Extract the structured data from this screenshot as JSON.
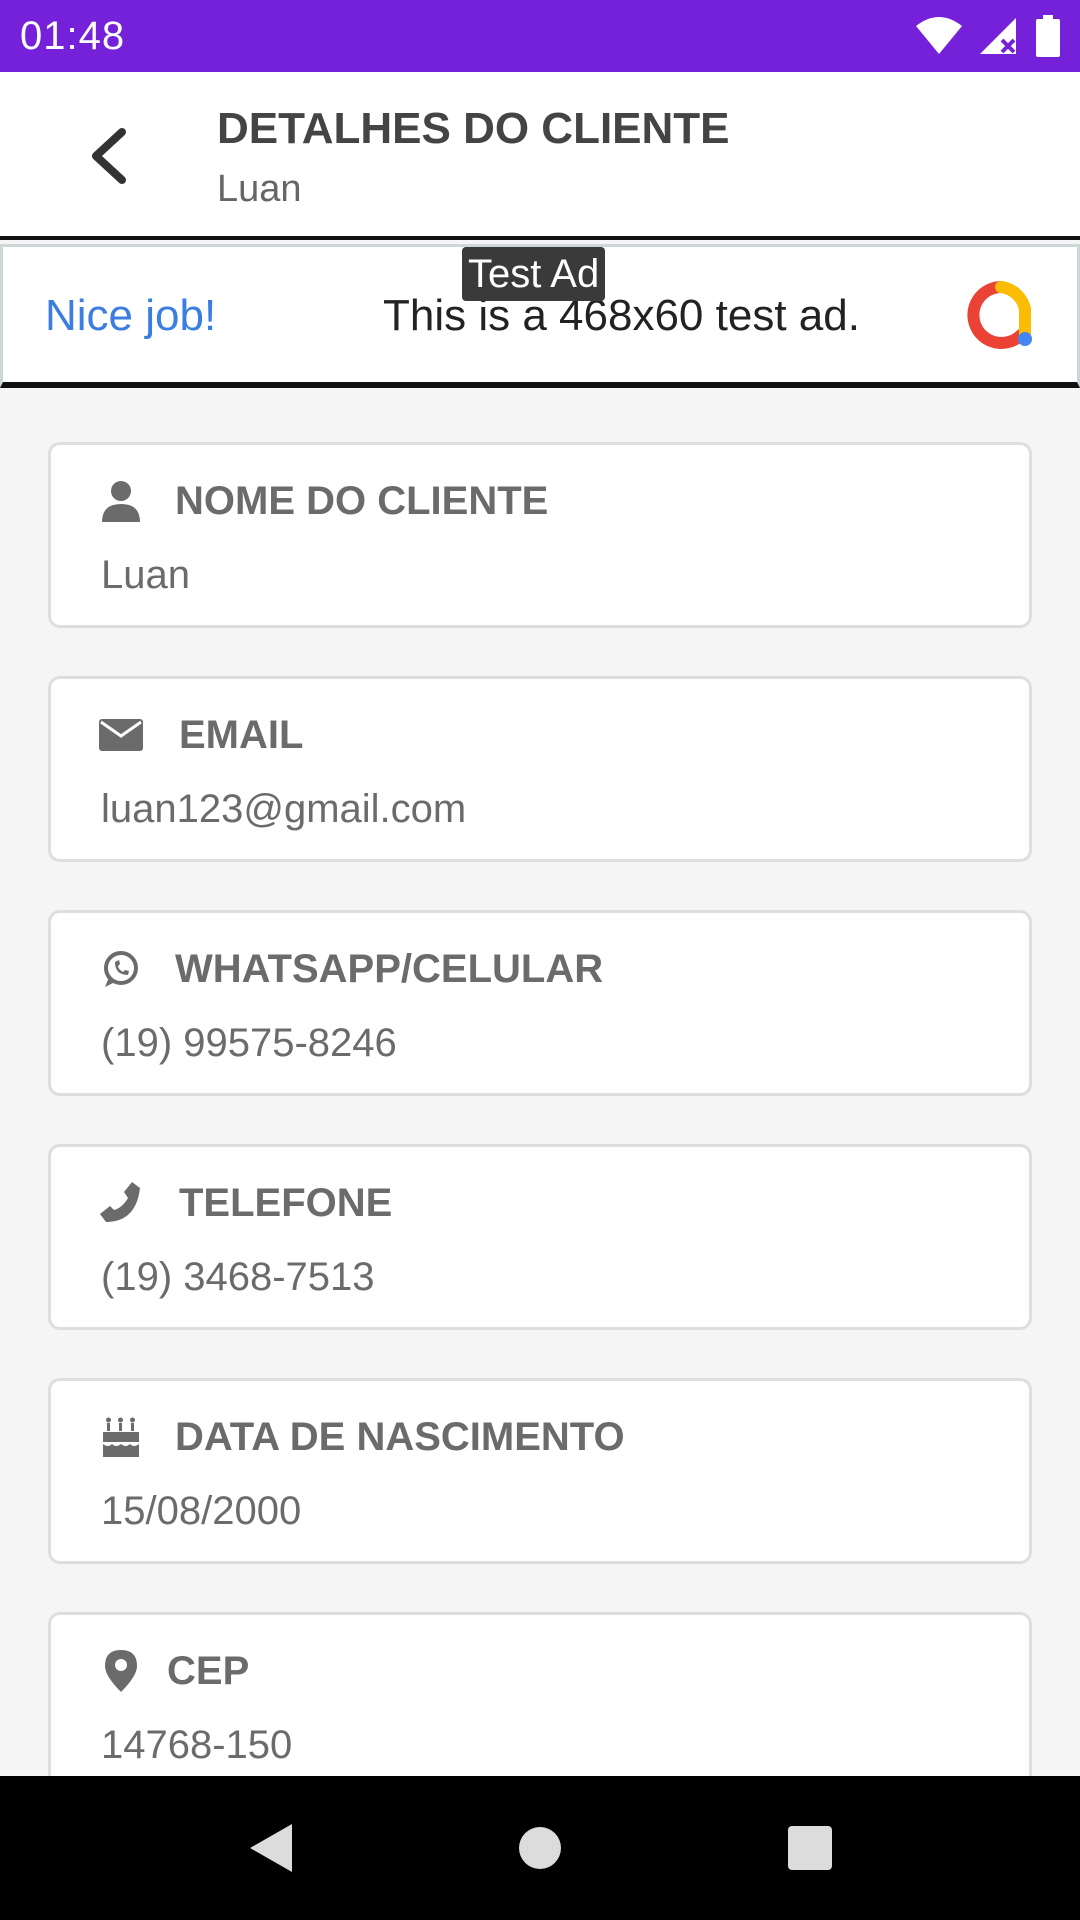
{
  "status_bar": {
    "time": "01:48",
    "color": "#7421d9"
  },
  "header": {
    "title": "DETALHES DO CLIENTE",
    "subtitle": "Luan",
    "back_icon": "chevron-left-icon"
  },
  "ad": {
    "label": "Test Ad",
    "headline": "Nice job!",
    "text": "This is a 468x60 test ad."
  },
  "fields": [
    {
      "icon": "user-icon",
      "label": "NOME DO CLIENTE",
      "value": "Luan"
    },
    {
      "icon": "envelope-icon",
      "label": "EMAIL",
      "value": "luan123@gmail.com"
    },
    {
      "icon": "whatsapp-icon",
      "label": "WHATSAPP/CELULAR",
      "value": "(19) 99575-8246"
    },
    {
      "icon": "phone-icon",
      "label": "TELEFONE",
      "value": "(19) 3468-7513"
    },
    {
      "icon": "birthday-cake-icon",
      "label": "DATA DE NASCIMENTO",
      "value": "15/08/2000"
    },
    {
      "icon": "map-marker-icon",
      "label": "CEP",
      "value": "14768-150"
    }
  ]
}
